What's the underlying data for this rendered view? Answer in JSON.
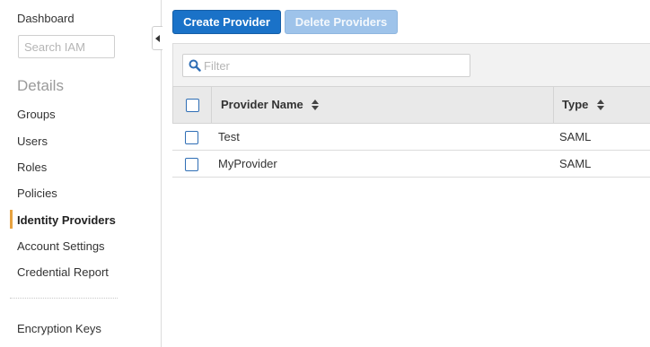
{
  "sidebar": {
    "dashboard_label": "Dashboard",
    "search_placeholder": "Search IAM",
    "section_heading": "Details",
    "items": [
      {
        "label": "Groups",
        "active": false
      },
      {
        "label": "Users",
        "active": false
      },
      {
        "label": "Roles",
        "active": false
      },
      {
        "label": "Policies",
        "active": false
      },
      {
        "label": "Identity Providers",
        "active": true
      },
      {
        "label": "Account Settings",
        "active": false
      },
      {
        "label": "Credential Report",
        "active": false
      }
    ],
    "footer_items": [
      {
        "label": "Encryption Keys"
      }
    ],
    "active_accent_color": "#e7a23f"
  },
  "toolbar": {
    "create_label": "Create Provider",
    "delete_label": "Delete Providers",
    "primary_color": "#1a72c8"
  },
  "table": {
    "filter_placeholder": "Filter",
    "filter_icon": "search-icon",
    "columns": [
      {
        "label": "Provider Name",
        "sort_icon": "sort-icon"
      },
      {
        "label": "Type",
        "sort_icon": "sort-icon"
      }
    ],
    "rows": [
      {
        "name": "Test",
        "type": "SAML"
      },
      {
        "name": "MyProvider",
        "type": "SAML"
      }
    ]
  },
  "collapse_icon": "triangle-left-icon"
}
